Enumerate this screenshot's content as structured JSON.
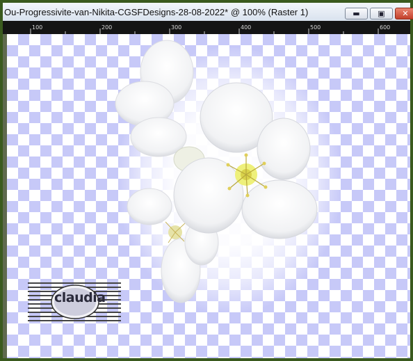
{
  "window": {
    "title": "Ou-Progressivite-van-Nikita-CGSFDesigns-28-08-2022* @ 100% (Raster 1)",
    "buttons": {
      "minimize_icon": "minimize-icon",
      "maximize_icon": "maximize-icon",
      "close_icon": "close-icon"
    }
  },
  "ruler": {
    "labels": [
      "100",
      "200",
      "300",
      "400",
      "500",
      "600"
    ]
  },
  "canvas": {
    "transparency_color": "#c7c9f8",
    "watermark": {
      "text": "claudia"
    }
  },
  "colors": {
    "frame": "#3a5a1e",
    "titlebar": "#e6ecf4",
    "ruler": "#141414",
    "close": "#c8452e"
  }
}
